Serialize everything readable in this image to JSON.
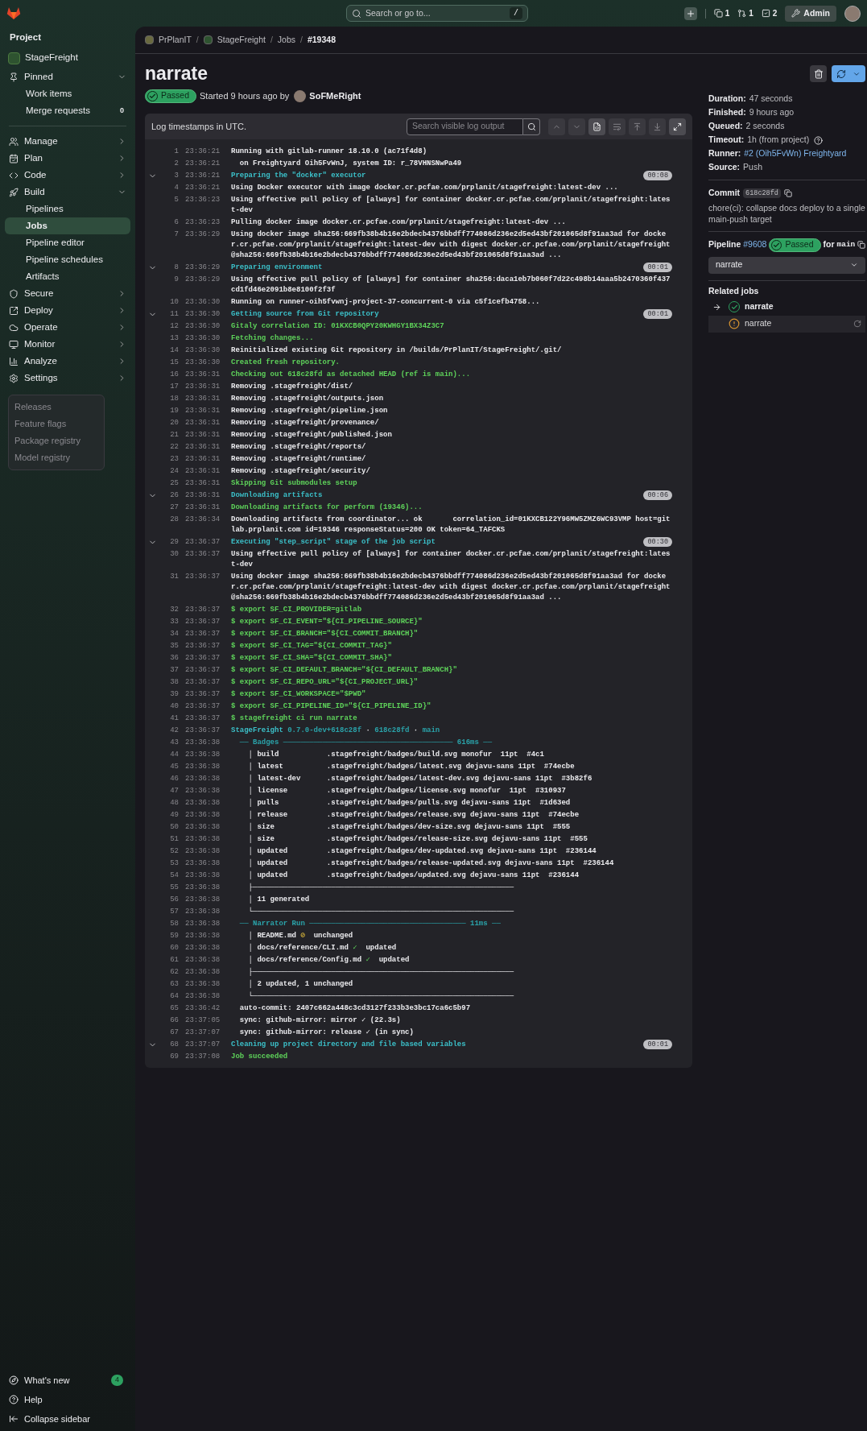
{
  "top_bar": {
    "search_placeholder": "Search or go to...",
    "shortcut": "/",
    "counters": [
      {
        "count": "1"
      },
      {
        "count": "1"
      },
      {
        "count": "2"
      }
    ],
    "admin_button": "Admin"
  },
  "sidebar": {
    "heading": "Project",
    "project": "StageFreight",
    "groups": [
      {
        "label": "Pinned",
        "expanded": true,
        "children": [
          {
            "label": "Work items",
            "selected": false
          },
          {
            "label": "Merge requests",
            "count": "0",
            "selected": false
          }
        ]
      },
      {
        "label": "Manage",
        "expanded": false
      },
      {
        "label": "Plan",
        "expanded": false
      },
      {
        "label": "Code",
        "expanded": false
      },
      {
        "label": "Build",
        "expanded": true,
        "children": [
          {
            "label": "Pipelines",
            "selected": false
          },
          {
            "label": "Jobs",
            "selected": true
          },
          {
            "label": "Pipeline editor",
            "selected": false
          },
          {
            "label": "Pipeline schedules",
            "selected": false
          },
          {
            "label": "Artifacts",
            "selected": false
          }
        ]
      },
      {
        "label": "Secure",
        "expanded": false
      },
      {
        "label": "Deploy",
        "expanded": false
      },
      {
        "label": "Operate",
        "expanded": false
      },
      {
        "label": "Monitor",
        "expanded": false
      },
      {
        "label": "Analyze",
        "expanded": false
      },
      {
        "label": "Settings",
        "expanded": false
      }
    ],
    "footer": [
      {
        "label": "What's new",
        "count": "4"
      },
      {
        "label": "Help"
      },
      {
        "label": "Collapse sidebar"
      }
    ]
  },
  "flyout": {
    "items": [
      "Releases",
      "Feature flags",
      "Package registry",
      "Model registry"
    ]
  },
  "breadcrumb": {
    "separator": "/",
    "items": [
      "PrPlanIT",
      "StageFreight",
      "Jobs",
      "#19348"
    ]
  },
  "job": {
    "title": "narrate",
    "status": {
      "label": "Passed",
      "kind": "success"
    },
    "started": "Started 9 hours ago by",
    "user": "SoFMeRight"
  },
  "log": {
    "note": "Log timestamps in UTC.",
    "search_placeholder": "Search visible log output",
    "lines": [
      {
        "num": "1",
        "time": "23:36:21",
        "kind": "plain",
        "text": "Running with gitlab-runner 18.10.0 (ac71f4d8)"
      },
      {
        "num": "2",
        "time": "23:36:21",
        "kind": "plain",
        "text": "  on Freightyard Oih5FvWnJ, system ID: r_78VHNSNwPa49"
      },
      {
        "num": "3",
        "time": "23:36:21",
        "kind": "section",
        "expanded": true,
        "duration": "00:08",
        "text": "Preparing the \"docker\" executor"
      },
      {
        "num": "4",
        "time": "23:36:21",
        "kind": "plain",
        "text": "Using Docker executor with image docker.cr.pcfae.com/prplanit/stagefreight:latest-dev ..."
      },
      {
        "num": "5",
        "time": "23:36:23",
        "kind": "plain",
        "text": "Using effective pull policy of [always] for container docker.cr.pcfae.com/prplanit/stagefreight:latest-dev"
      },
      {
        "num": "6",
        "time": "23:36:23",
        "kind": "plain",
        "text": "Pulling docker image docker.cr.pcfae.com/prplanit/stagefreight:latest-dev ..."
      },
      {
        "num": "7",
        "time": "23:36:29",
        "kind": "plain",
        "text": "Using docker image sha256:669fb38b4b16e2bdecb4376bbdff774086d236e2d5ed43bf201065d8f91aa3ad for docker.cr.pcfae.com/prplanit/stagefreight:latest-dev with digest docker.cr.pcfae.com/prplanit/stagefreight@sha256:669fb38b4b16e2bdecb4376bbdff774086d236e2d5ed43bf201065d8f91aa3ad ..."
      },
      {
        "num": "8",
        "time": "23:36:29",
        "kind": "section",
        "expanded": true,
        "duration": "00:01",
        "text": "Preparing environment"
      },
      {
        "num": "9",
        "time": "23:36:29",
        "kind": "plain",
        "text": "Using effective pull policy of [always] for container sha256:daca1eb7b060f7d22c498b14aaa5b2470360f437cd1fd46e2091b8e8100f2f3f"
      },
      {
        "num": "10",
        "time": "23:36:30",
        "kind": "plain",
        "text": "Running on runner-oih5fvwnj-project-37-concurrent-0 via c5f1cefb4758..."
      },
      {
        "num": "11",
        "time": "23:36:30",
        "kind": "section",
        "expanded": true,
        "duration": "00:01",
        "text": "Getting source from Git repository"
      },
      {
        "num": "12",
        "time": "23:36:30",
        "kind": "success",
        "text": "Gitaly correlation ID: 01KXCB0QPY20KWHGY1BX34Z3C7"
      },
      {
        "num": "13",
        "time": "23:36:30",
        "kind": "success",
        "text": "Fetching changes..."
      },
      {
        "num": "14",
        "time": "23:36:30",
        "kind": "plain",
        "text": "Reinitialized existing Git repository in /builds/PrPlanIT/StageFreight/.git/"
      },
      {
        "num": "15",
        "time": "23:36:30",
        "kind": "success",
        "text": "Created fresh repository."
      },
      {
        "num": "16",
        "time": "23:36:31",
        "kind": "success",
        "text": "Checking out 618c28fd as detached HEAD (ref is main)..."
      },
      {
        "num": "17",
        "time": "23:36:31",
        "kind": "plain",
        "text": "Removing .stagefreight/dist/"
      },
      {
        "num": "18",
        "time": "23:36:31",
        "kind": "plain",
        "text": "Removing .stagefreight/outputs.json"
      },
      {
        "num": "19",
        "time": "23:36:31",
        "kind": "plain",
        "text": "Removing .stagefreight/pipeline.json"
      },
      {
        "num": "20",
        "time": "23:36:31",
        "kind": "plain",
        "text": "Removing .stagefreight/provenance/"
      },
      {
        "num": "21",
        "time": "23:36:31",
        "kind": "plain",
        "text": "Removing .stagefreight/published.json"
      },
      {
        "num": "22",
        "time": "23:36:31",
        "kind": "plain",
        "text": "Removing .stagefreight/reports/"
      },
      {
        "num": "23",
        "time": "23:36:31",
        "kind": "plain",
        "text": "Removing .stagefreight/runtime/"
      },
      {
        "num": "24",
        "time": "23:36:31",
        "kind": "plain",
        "text": "Removing .stagefreight/security/"
      },
      {
        "num": "25",
        "time": "23:36:31",
        "kind": "success",
        "text": "Skipping Git submodules setup"
      },
      {
        "num": "26",
        "time": "23:36:31",
        "kind": "section",
        "expanded": true,
        "duration": "00:06",
        "text": "Downloading artifacts"
      },
      {
        "num": "27",
        "time": "23:36:31",
        "kind": "success",
        "text": "Downloading artifacts for perform (19346)..."
      },
      {
        "num": "28",
        "time": "23:36:34",
        "kind": "plain",
        "text": "Downloading artifacts from coordinator... ok       correlation_id=01KXCB122Y96MW5ZMZ6WC93VMP host=gitlab.prplanit.com id=19346 responseStatus=200 OK token=64_TAFCKS"
      },
      {
        "num": "29",
        "time": "23:36:37",
        "kind": "section",
        "expanded": true,
        "duration": "00:30",
        "text": "Executing \"step_script\" stage of the job script"
      },
      {
        "num": "30",
        "time": "23:36:37",
        "kind": "plain",
        "text": "Using effective pull policy of [always] for container docker.cr.pcfae.com/prplanit/stagefreight:latest-dev"
      },
      {
        "num": "31",
        "time": "23:36:37",
        "kind": "plain",
        "text": "Using docker image sha256:669fb38b4b16e2bdecb4376bbdff774086d236e2d5ed43bf201065d8f91aa3ad for docker.cr.pcfae.com/prplanit/stagefreight:latest-dev with digest docker.cr.pcfae.com/prplanit/stagefreight@sha256:669fb38b4b16e2bdecb4376bbdff774086d236e2d5ed43bf201065d8f91aa3ad ..."
      },
      {
        "num": "32",
        "time": "23:36:37",
        "kind": "success",
        "text": "$ export SF_CI_PROVIDER=gitlab"
      },
      {
        "num": "33",
        "time": "23:36:37",
        "kind": "success",
        "text": "$ export SF_CI_EVENT=\"${CI_PIPELINE_SOURCE}\""
      },
      {
        "num": "34",
        "time": "23:36:37",
        "kind": "success",
        "text": "$ export SF_CI_BRANCH=\"${CI_COMMIT_BRANCH}\""
      },
      {
        "num": "35",
        "time": "23:36:37",
        "kind": "success",
        "text": "$ export SF_CI_TAG=\"${CI_COMMIT_TAG}\""
      },
      {
        "num": "36",
        "time": "23:36:37",
        "kind": "success",
        "text": "$ export SF_CI_SHA=\"${CI_COMMIT_SHA}\""
      },
      {
        "num": "37",
        "time": "23:36:37",
        "kind": "success",
        "text": "$ export SF_CI_DEFAULT_BRANCH=\"${CI_DEFAULT_BRANCH}\""
      },
      {
        "num": "38",
        "time": "23:36:37",
        "kind": "success",
        "text": "$ export SF_CI_REPO_URL=\"${CI_PROJECT_URL}\""
      },
      {
        "num": "39",
        "time": "23:36:37",
        "kind": "success",
        "text": "$ export SF_CI_WORKSPACE=\"$PWD\""
      },
      {
        "num": "40",
        "time": "23:36:37",
        "kind": "success",
        "text": "$ export SF_CI_PIPELINE_ID=\"${CI_PIPELINE_ID}\""
      },
      {
        "num": "41",
        "time": "23:36:37",
        "kind": "success",
        "text": "$ stagefreight ci run narrate"
      },
      {
        "num": "42",
        "time": "23:36:37",
        "kind": "mixed",
        "parts": [
          {
            "kind": "info",
            "text": "StageFreight"
          },
          {
            "kind": "meta",
            "text": " 0.7.0-dev+618c28f"
          },
          {
            "kind": "plain",
            "text": " · "
          },
          {
            "kind": "meta",
            "text": "618c28fd"
          },
          {
            "kind": "plain",
            "text": " · "
          },
          {
            "kind": "meta",
            "text": "main"
          }
        ]
      },
      {
        "num": "43",
        "time": "23:36:38",
        "kind": "rule",
        "text": "  ── Badges ─────────────────────────────────────── 616ms ──"
      },
      {
        "num": "44",
        "time": "23:36:38",
        "kind": "plain",
        "text": "    │ build           .stagefreight/badges/build.svg monofur  11pt  #4c1"
      },
      {
        "num": "45",
        "time": "23:36:38",
        "kind": "plain",
        "text": "    │ latest          .stagefreight/badges/latest.svg dejavu-sans 11pt  #74ecbe"
      },
      {
        "num": "46",
        "time": "23:36:38",
        "kind": "plain",
        "text": "    │ latest-dev      .stagefreight/badges/latest-dev.svg dejavu-sans 11pt  #3b82f6"
      },
      {
        "num": "47",
        "time": "23:36:38",
        "kind": "plain",
        "text": "    │ license         .stagefreight/badges/license.svg monofur  11pt  #310937"
      },
      {
        "num": "48",
        "time": "23:36:38",
        "kind": "plain",
        "text": "    │ pulls           .stagefreight/badges/pulls.svg dejavu-sans 11pt  #1d63ed"
      },
      {
        "num": "49",
        "time": "23:36:38",
        "kind": "plain",
        "text": "    │ release         .stagefreight/badges/release.svg dejavu-sans 11pt  #74ecbe"
      },
      {
        "num": "50",
        "time": "23:36:38",
        "kind": "plain",
        "text": "    │ size            .stagefreight/badges/dev-size.svg dejavu-sans 11pt  #555"
      },
      {
        "num": "51",
        "time": "23:36:38",
        "kind": "plain",
        "text": "    │ size            .stagefreight/badges/release-size.svg dejavu-sans 11pt  #555"
      },
      {
        "num": "52",
        "time": "23:36:38",
        "kind": "plain",
        "text": "    │ updated         .stagefreight/badges/dev-updated.svg dejavu-sans 11pt  #236144"
      },
      {
        "num": "53",
        "time": "23:36:38",
        "kind": "plain",
        "text": "    │ updated         .stagefreight/badges/release-updated.svg dejavu-sans 11pt  #236144"
      },
      {
        "num": "54",
        "time": "23:36:38",
        "kind": "plain",
        "text": "    │ updated         .stagefreight/badges/updated.svg dejavu-sans 11pt  #236144"
      },
      {
        "num": "55",
        "time": "23:36:38",
        "kind": "plain",
        "text": "    ├────────────────────────────────────────────────────────────"
      },
      {
        "num": "56",
        "time": "23:36:38",
        "kind": "plain",
        "text": "    │ 11 generated"
      },
      {
        "num": "57",
        "time": "23:36:38",
        "kind": "plain",
        "text": "    └────────────────────────────────────────────────────────────"
      },
      {
        "num": "58",
        "time": "23:36:38",
        "kind": "rule",
        "text": "  ── Narrator Run ──────────────────────────────────── 11ms ──"
      },
      {
        "num": "59",
        "time": "23:36:38",
        "kind": "mixed",
        "parts": [
          {
            "kind": "plain",
            "text": "    │ README.md "
          },
          {
            "kind": "warning",
            "text": "⊘"
          },
          {
            "kind": "plain",
            "text": "  unchanged"
          }
        ]
      },
      {
        "num": "60",
        "time": "23:36:38",
        "kind": "mixed",
        "parts": [
          {
            "kind": "plain",
            "text": "    │ docs/reference/CLI.md "
          },
          {
            "kind": "success",
            "text": "✓"
          },
          {
            "kind": "plain",
            "text": "  updated"
          }
        ]
      },
      {
        "num": "61",
        "time": "23:36:38",
        "kind": "mixed",
        "parts": [
          {
            "kind": "plain",
            "text": "    │ docs/reference/Config.md "
          },
          {
            "kind": "success",
            "text": "✓"
          },
          {
            "kind": "plain",
            "text": "  updated"
          }
        ]
      },
      {
        "num": "62",
        "time": "23:36:38",
        "kind": "plain",
        "text": "    ├────────────────────────────────────────────────────────────"
      },
      {
        "num": "63",
        "time": "23:36:38",
        "kind": "plain",
        "text": "    │ 2 updated, 1 unchanged"
      },
      {
        "num": "64",
        "time": "23:36:38",
        "kind": "plain",
        "text": "    └────────────────────────────────────────────────────────────"
      },
      {
        "num": "65",
        "time": "23:36:42",
        "kind": "plain",
        "text": "  auto-commit: 2407c662a448c3cd3127f233b3e3bc17ca6c5b97"
      },
      {
        "num": "66",
        "time": "23:37:05",
        "kind": "plain",
        "text": "  sync: github-mirror: mirror ✓ (22.3s)"
      },
      {
        "num": "67",
        "time": "23:37:07",
        "kind": "plain",
        "text": "  sync: github-mirror: release ✓ (in sync)"
      },
      {
        "num": "68",
        "time": "23:37:07",
        "kind": "section",
        "expanded": true,
        "duration": "00:01",
        "text": "Cleaning up project directory and file based variables"
      },
      {
        "num": "69",
        "time": "23:37:08",
        "kind": "success",
        "text": "Job succeeded"
      }
    ]
  },
  "details": {
    "items": [
      {
        "label": "Duration:",
        "value": "47 seconds",
        "kind": "text"
      },
      {
        "label": "Finished:",
        "value": "9 hours ago",
        "kind": "text"
      },
      {
        "label": "Queued:",
        "value": "2 seconds",
        "kind": "text"
      },
      {
        "label": "Timeout:",
        "value": "1h (from project)",
        "kind": "help"
      },
      {
        "label": "Runner:",
        "value": "#2 (Oih5FvWn) Freightyard",
        "kind": "link"
      },
      {
        "label": "Source:",
        "value": "Push",
        "kind": "text"
      }
    ],
    "commit": {
      "label": "Commit",
      "sha": "618c28fd",
      "message": "chore(ci): collapse docs deploy to a single main-push target"
    },
    "pipeline": {
      "label": "Pipeline",
      "number": "#9608",
      "status": {
        "label": "Passed",
        "kind": "success"
      },
      "for": "for",
      "ref": "main",
      "stage": "narrate"
    },
    "related": {
      "heading": "Related jobs",
      "jobs": [
        {
          "name": "narrate",
          "kind": "success",
          "current": true,
          "retried": false
        },
        {
          "name": "narrate",
          "kind": "warning",
          "current": false,
          "retried": true
        }
      ]
    }
  }
}
